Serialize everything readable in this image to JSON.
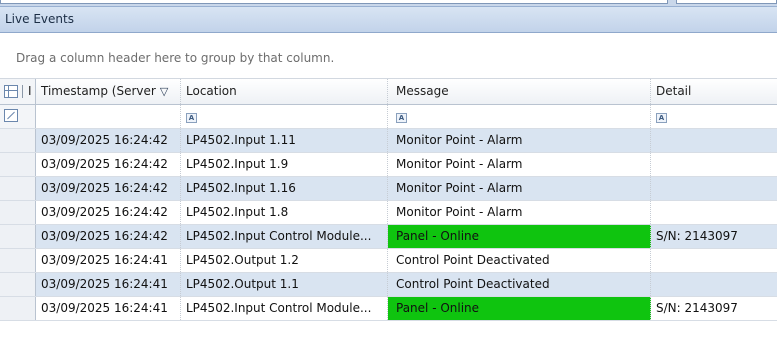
{
  "panel": {
    "title": "Live Events"
  },
  "group_hint": "Drag a column header here to group by that column.",
  "columns": [
    {
      "label": "I"
    },
    {
      "label": "Timestamp (Server",
      "sort_icon": "filter-funnel-icon"
    },
    {
      "label": "Location"
    },
    {
      "label": "Message"
    },
    {
      "label": "Detail"
    }
  ],
  "filter_icon_label": "A",
  "rows": [
    {
      "timestamp": "03/09/2025 16:24:42",
      "location": "LP4502.Input 1.11",
      "message": "Monitor Point - Alarm",
      "detail": "",
      "highlight": ""
    },
    {
      "timestamp": "03/09/2025 16:24:42",
      "location": "LP4502.Input 1.9",
      "message": "Monitor Point - Alarm",
      "detail": "",
      "highlight": ""
    },
    {
      "timestamp": "03/09/2025 16:24:42",
      "location": "LP4502.Input 1.16",
      "message": "Monitor Point - Alarm",
      "detail": "",
      "highlight": ""
    },
    {
      "timestamp": "03/09/2025 16:24:42",
      "location": "LP4502.Input 1.8",
      "message": "Monitor Point - Alarm",
      "detail": "",
      "highlight": ""
    },
    {
      "timestamp": "03/09/2025 16:24:42",
      "location": "LP4502.Input Control Module...",
      "message": "Panel - Online",
      "detail": "S/N: 2143097",
      "highlight": "#0fc40f"
    },
    {
      "timestamp": "03/09/2025 16:24:41",
      "location": "LP4502.Output 1.2",
      "message": "Control Point Deactivated",
      "detail": "",
      "highlight": ""
    },
    {
      "timestamp": "03/09/2025 16:24:41",
      "location": "LP4502.Output 1.1",
      "message": "Control Point Deactivated",
      "detail": "",
      "highlight": ""
    },
    {
      "timestamp": "03/09/2025 16:24:41",
      "location": "LP4502.Input Control Module...",
      "message": "Panel - Online",
      "detail": "S/N: 2143097",
      "highlight": "#0fc40f"
    }
  ],
  "colors": {
    "row_alt": "#d9e4f1",
    "panel_online": "#0fc40f"
  }
}
